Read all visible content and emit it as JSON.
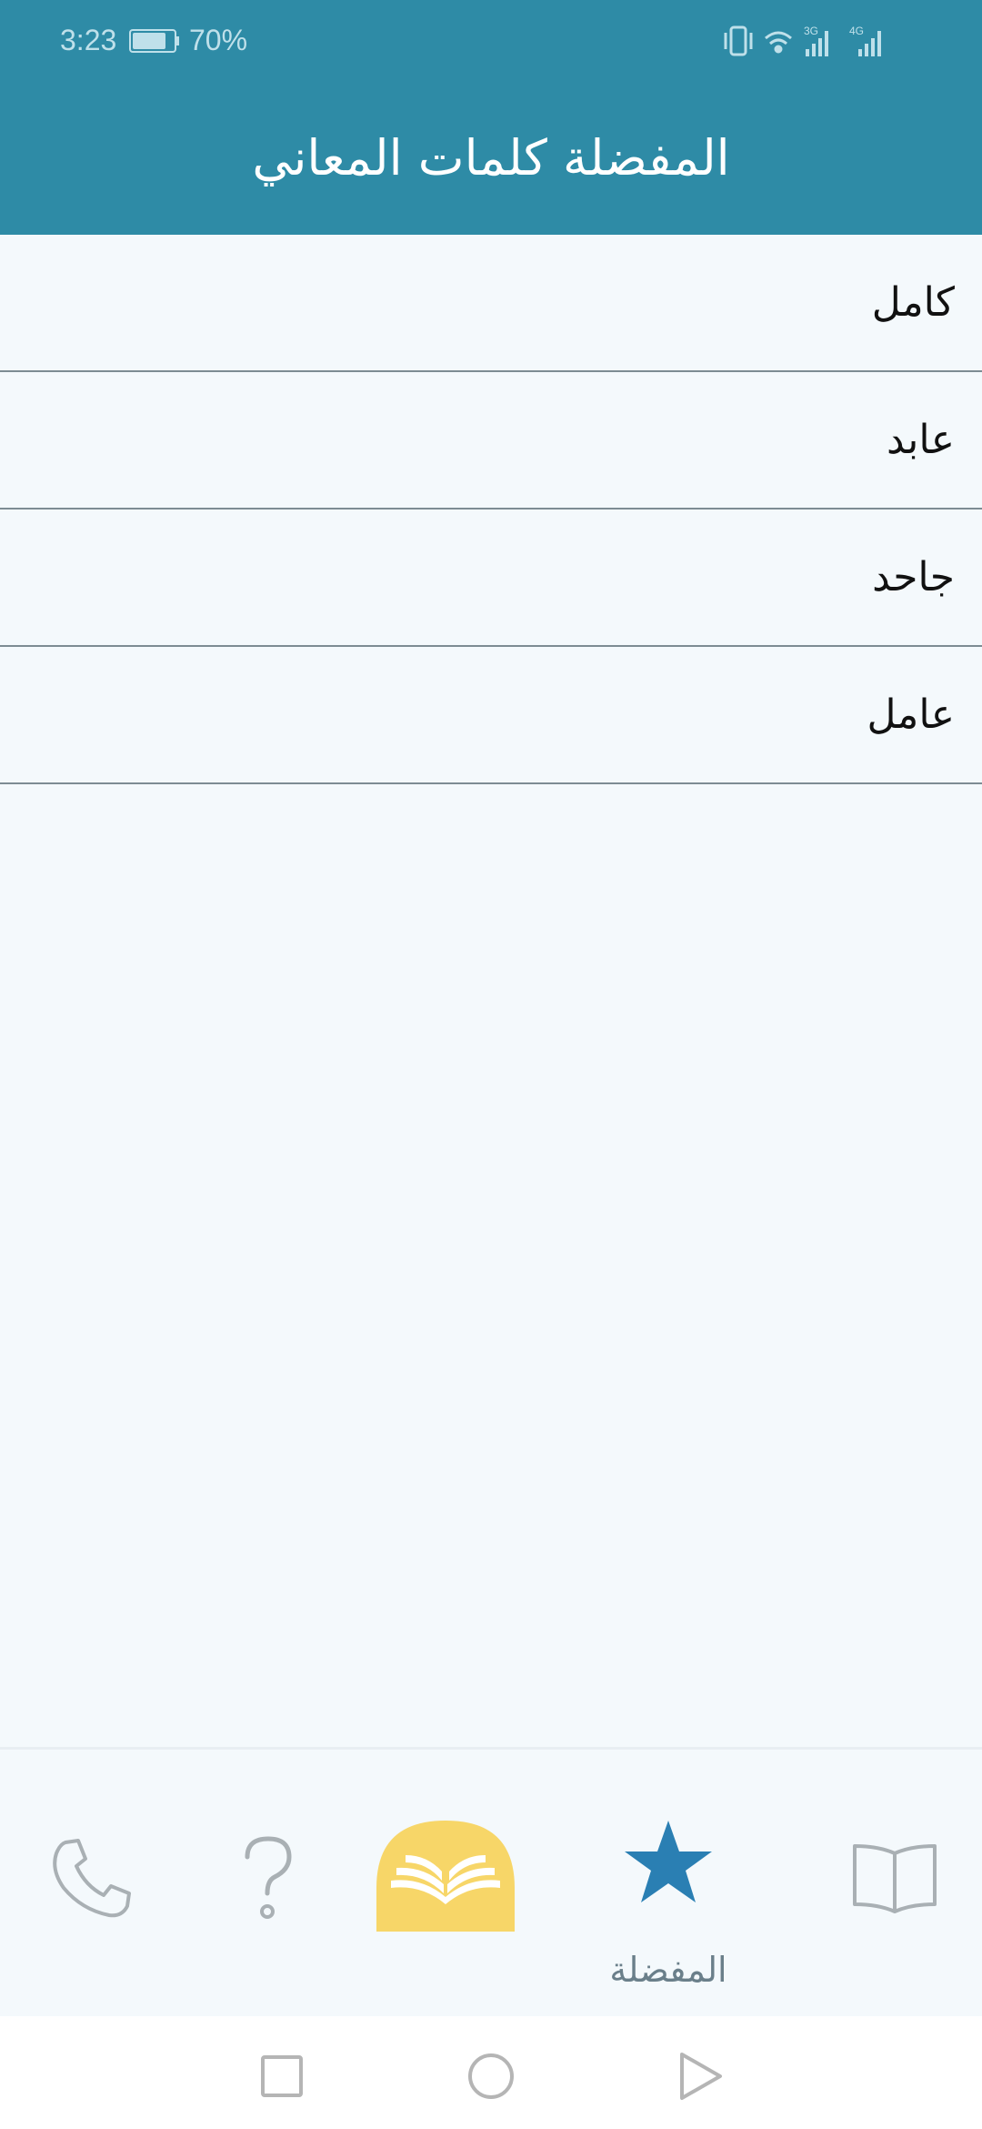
{
  "status_bar": {
    "time": "3:23",
    "battery_percent": "70%",
    "net_3g": "3G",
    "net_4g": "4G"
  },
  "header": {
    "title": "المفضلة كلمات المعاني"
  },
  "favorites": [
    {
      "word": "كامل"
    },
    {
      "word": "عابد"
    },
    {
      "word": "جاحد"
    },
    {
      "word": "عامل"
    }
  ],
  "bottom_nav": {
    "items": [
      {
        "icon": "phone-icon",
        "label": ""
      },
      {
        "icon": "question-icon",
        "label": ""
      },
      {
        "icon": "app-logo-book-icon",
        "label": ""
      },
      {
        "icon": "star-icon",
        "label": "المفضلة",
        "active": true
      },
      {
        "icon": "open-book-icon",
        "label": ""
      }
    ]
  },
  "colors": {
    "header_bg": "#2e8ba6",
    "star_active": "#2a7fb3",
    "logo_yellow": "#f7d668",
    "page_bg": "#f4f9fc"
  }
}
